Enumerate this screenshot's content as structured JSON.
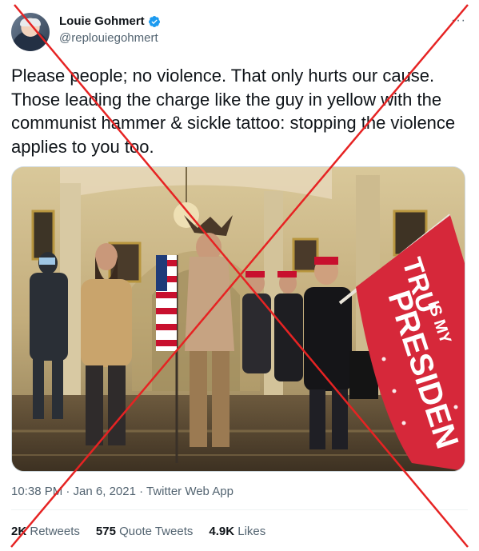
{
  "tweet": {
    "author_name": "Louie Gohmert",
    "handle": "@replouiegohmert",
    "text": "Please people; no violence. That only hurts our cause. Those leading the charge like the guy in yellow with the communist hammer & sickle tattoo: stopping the violence applies to you too.",
    "timestamp": "10:38 PM · Jan 6, 2021 · Twitter Web App",
    "retweets_count": "2K",
    "retweets_label": "Retweets",
    "quote_count": "575",
    "quote_label": "Quote Tweets",
    "likes_count": "4.9K",
    "likes_label": "Likes"
  },
  "media": {
    "flag_text_top": "TRU",
    "flag_text_mid": "IS MY",
    "flag_text_bottom": "PRESIDEN"
  },
  "colors": {
    "verified_blue": "#1d9bf0",
    "cross_red": "#e62323",
    "muted_text": "#536471"
  }
}
